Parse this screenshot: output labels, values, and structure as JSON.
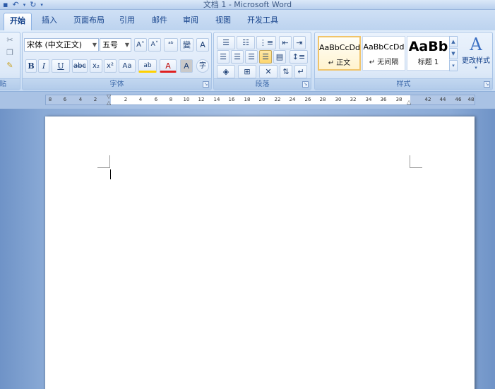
{
  "window": {
    "title": "文档 1 - Microsoft Word",
    "qat": [
      "save-icon",
      "undo-icon",
      "redo-icon",
      "customize-icon"
    ]
  },
  "tabs": [
    "开始",
    "插入",
    "页面布局",
    "引用",
    "邮件",
    "审阅",
    "视图",
    "开发工具"
  ],
  "active_tab": "开始",
  "font_group": {
    "label": "字体",
    "font_name": "宋体 (中文正文)",
    "font_size": "五号",
    "grow": "A˄",
    "shrink": "A˅",
    "clear": "ᵃᵇ",
    "phonetic": "變",
    "border": "A",
    "bold": "B",
    "italic": "I",
    "underline": "U",
    "strike": "abc",
    "subscript": "x₂",
    "superscript": "x²",
    "case": "Aa",
    "highlight": "ab",
    "font_color": "A",
    "shading": "A",
    "enclose": "字"
  },
  "paragraph_group": {
    "label": "段落"
  },
  "styles_group": {
    "label": "样式",
    "tiles": [
      {
        "sample": "AaBbCcDd",
        "name": "↵ 正文"
      },
      {
        "sample": "AaBbCcDd",
        "name": "↵ 无间隔"
      },
      {
        "sample": "AaBb",
        "name": "标题 1"
      }
    ],
    "change_styles": "更改样式"
  },
  "clipboard_group": {
    "label": "贴"
  },
  "ruler": {
    "left_ticks": [
      "8",
      "6",
      "4",
      "2"
    ],
    "right_ticks": [
      "2",
      "4",
      "6",
      "8",
      "10",
      "12",
      "14",
      "16",
      "18",
      "20",
      "22",
      "24",
      "26",
      "28",
      "30",
      "32",
      "34",
      "36",
      "38"
    ],
    "after_ticks": [
      "42",
      "44",
      "46",
      "48"
    ]
  },
  "colors": {
    "accent": "#15428b",
    "ribbon": "#dde9f8",
    "workspace": "#a5bfe3",
    "active_style": "#f0c46a",
    "highlight": "#ffd100",
    "font_color": "#e02020"
  }
}
